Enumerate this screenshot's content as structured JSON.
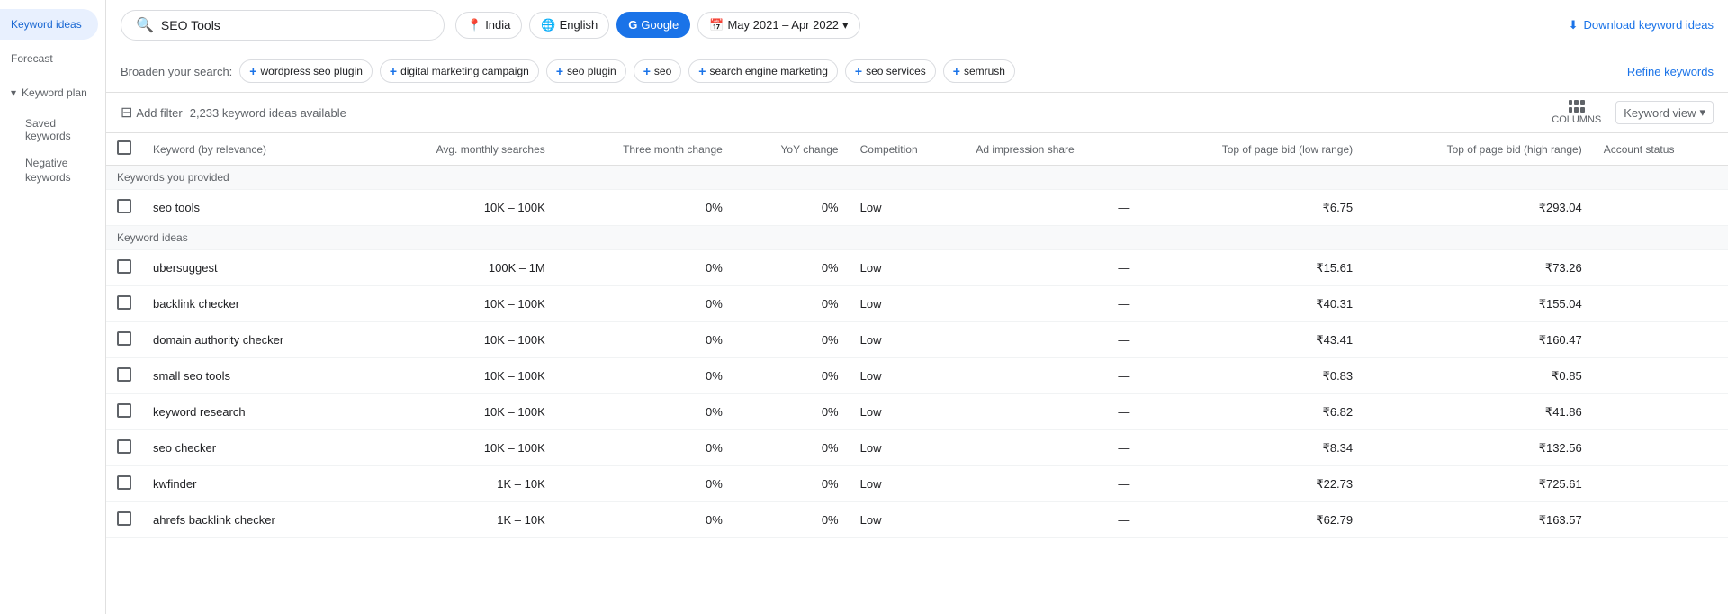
{
  "sidebar": {
    "items": [
      {
        "id": "keyword-ideas",
        "label": "Keyword ideas",
        "active": true
      },
      {
        "id": "forecast",
        "label": "Forecast",
        "active": false
      },
      {
        "id": "keyword-plan",
        "label": "Keyword plan",
        "active": false,
        "expandable": true
      },
      {
        "id": "saved-keywords",
        "label": "Saved keywords",
        "active": false
      },
      {
        "id": "negative-keywords",
        "label": "Negative keywords",
        "active": false
      }
    ]
  },
  "header": {
    "search_placeholder": "SEO Tools",
    "search_value": "SEO Tools",
    "location": "India",
    "language": "English",
    "engine": "Google",
    "date_range": "May 2021 – Apr 2022",
    "download_label": "Download keyword ideas"
  },
  "broaden": {
    "label": "Broaden your search:",
    "tags": [
      "wordpress seo plugin",
      "digital marketing campaign",
      "seo plugin",
      "seo",
      "search engine marketing",
      "seo services",
      "semrush"
    ],
    "refine_label": "Refine keywords"
  },
  "filter_bar": {
    "add_filter_label": "Add filter",
    "count_text": "2,233 keyword ideas available",
    "columns_label": "COLUMNS",
    "view_label": "Keyword view"
  },
  "table": {
    "columns": [
      "Keyword (by relevance)",
      "Avg. monthly searches",
      "Three month change",
      "YoY change",
      "Competition",
      "Ad impression share",
      "Top of page bid (low range)",
      "Top of page bid (high range)",
      "Account status"
    ],
    "sections": [
      {
        "header": "Keywords you provided",
        "rows": [
          {
            "keyword": "seo tools",
            "avg_monthly": "10K – 100K",
            "three_month": "0%",
            "yoy": "0%",
            "competition": "Low",
            "ad_impression": "—",
            "bid_low": "₹6.75",
            "bid_high": "₹293.04",
            "account_status": ""
          }
        ]
      },
      {
        "header": "Keyword ideas",
        "rows": [
          {
            "keyword": "ubersuggest",
            "avg_monthly": "100K – 1M",
            "three_month": "0%",
            "yoy": "0%",
            "competition": "Low",
            "ad_impression": "—",
            "bid_low": "₹15.61",
            "bid_high": "₹73.26",
            "account_status": ""
          },
          {
            "keyword": "backlink checker",
            "avg_monthly": "10K – 100K",
            "three_month": "0%",
            "yoy": "0%",
            "competition": "Low",
            "ad_impression": "—",
            "bid_low": "₹40.31",
            "bid_high": "₹155.04",
            "account_status": ""
          },
          {
            "keyword": "domain authority checker",
            "avg_monthly": "10K – 100K",
            "three_month": "0%",
            "yoy": "0%",
            "competition": "Low",
            "ad_impression": "—",
            "bid_low": "₹43.41",
            "bid_high": "₹160.47",
            "account_status": ""
          },
          {
            "keyword": "small seo tools",
            "avg_monthly": "10K – 100K",
            "three_month": "0%",
            "yoy": "0%",
            "competition": "Low",
            "ad_impression": "—",
            "bid_low": "₹0.83",
            "bid_high": "₹0.85",
            "account_status": ""
          },
          {
            "keyword": "keyword research",
            "avg_monthly": "10K – 100K",
            "three_month": "0%",
            "yoy": "0%",
            "competition": "Low",
            "ad_impression": "—",
            "bid_low": "₹6.82",
            "bid_high": "₹41.86",
            "account_status": ""
          },
          {
            "keyword": "seo checker",
            "avg_monthly": "10K – 100K",
            "three_month": "0%",
            "yoy": "0%",
            "competition": "Low",
            "ad_impression": "—",
            "bid_low": "₹8.34",
            "bid_high": "₹132.56",
            "account_status": ""
          },
          {
            "keyword": "kwfinder",
            "avg_monthly": "1K – 10K",
            "three_month": "0%",
            "yoy": "0%",
            "competition": "Low",
            "ad_impression": "—",
            "bid_low": "₹22.73",
            "bid_high": "₹725.61",
            "account_status": ""
          },
          {
            "keyword": "ahrefs backlink checker",
            "avg_monthly": "1K – 10K",
            "three_month": "0%",
            "yoy": "0%",
            "competition": "Low",
            "ad_impression": "—",
            "bid_low": "₹62.79",
            "bid_high": "₹163.57",
            "account_status": ""
          }
        ]
      }
    ]
  },
  "icons": {
    "search": "🔍",
    "location": "📍",
    "language": "🌐",
    "google": "G",
    "calendar": "📅",
    "download": "⬇",
    "filter": "⊟",
    "plus": "+",
    "chevron_down": "▾",
    "chevron_right": "›"
  }
}
